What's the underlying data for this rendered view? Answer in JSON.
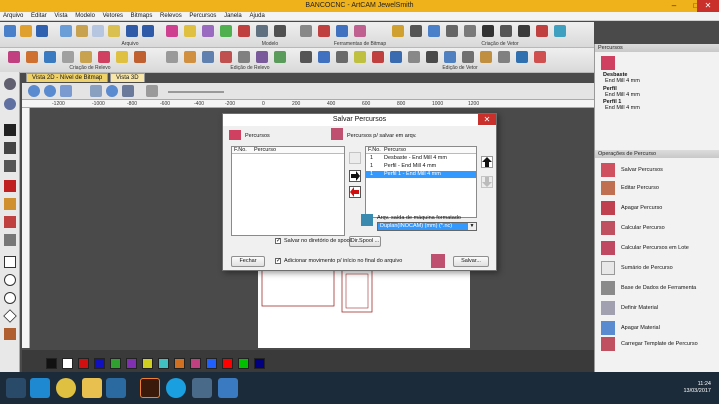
{
  "window": {
    "title": "BANCOCNC - ArtCAM JewelSmith"
  },
  "menu": [
    "Arquivo",
    "Editar",
    "Vista",
    "Modelo",
    "Vetores",
    "Bitmaps",
    "Relevos",
    "Percursos",
    "Janela",
    "Ajuda"
  ],
  "toolbar_groups": {
    "arquivo": "Arquivo",
    "modelo": "Modelo",
    "ferramentas_bitmap": "Ferramentas de Bitmap",
    "criacao_vetor": "Criação de Vetor",
    "criacao_relevo": "Criação de Relevo",
    "edicao_relevo": "Edição de Relevo",
    "edicao_vetor": "Edição de Vetor"
  },
  "tabs": {
    "vista2d": "Vista 2D - Nível de Bitmap",
    "vista3d": "Vista 3D"
  },
  "ruler_ticks": [
    "-1200",
    "-1000",
    "-800",
    "-600",
    "-400",
    "-200",
    "0",
    "200",
    "400",
    "600",
    "800",
    "1000",
    "1200"
  ],
  "palette": [
    "#111111",
    "#ffffff",
    "#d01010",
    "#1010c0",
    "#30a030",
    "#8030b0",
    "#d0d020",
    "#40c0c0",
    "#d07020",
    "#c04080",
    "#2060ff",
    "#ff0000",
    "#00c000",
    "#000080"
  ],
  "right_panel": {
    "title": "Percursos",
    "toolpaths": [
      {
        "name": "Desbaste",
        "tool": "End Mill 4 mm"
      },
      {
        "name": "Perfil",
        "tool": "End Mill 4 mm"
      },
      {
        "name": "Perfil 1",
        "tool": "End Mill 4 mm"
      }
    ],
    "ops_title": "Operações de Percurso",
    "ops": [
      "Salvar Percursos",
      "Editar Percurso",
      "Apagar Percurso",
      "Calcular Percurso",
      "Calcular Percursos em Lote",
      "Sumário de Percurso",
      "Base de Dados de Ferramenta",
      "Definir Material",
      "Apagar Material",
      "Carregar Template de Percurso"
    ]
  },
  "dialog": {
    "title": "Salvar Percursos",
    "left_label": "Percursos",
    "right_label": "Percursos p/ salvar em arqv.",
    "col_fno": "F.No.",
    "col_percurso": "Percurso",
    "save_list": [
      {
        "fno": "1",
        "name": "Desbaste - End Mill 4 mm"
      },
      {
        "fno": "1",
        "name": "Perfil - End Mill 4 mm"
      },
      {
        "fno": "1",
        "name": "Perfil 1 - End Mill 4 mm"
      }
    ],
    "format_label": "Arqv. saída de máquina formatado",
    "format_value": "Duplan(INOCAM) (mm) (*.nc)",
    "dir_button": "Dir.Spool ...",
    "chk_spool": "Salvar no diretório de spool",
    "chk_move": "Adicionar movimento p/ início no final do arquivo",
    "close": "Fechar",
    "save": "Salvar..."
  },
  "clock": {
    "time": "11:24",
    "date": "13/03/2017"
  }
}
